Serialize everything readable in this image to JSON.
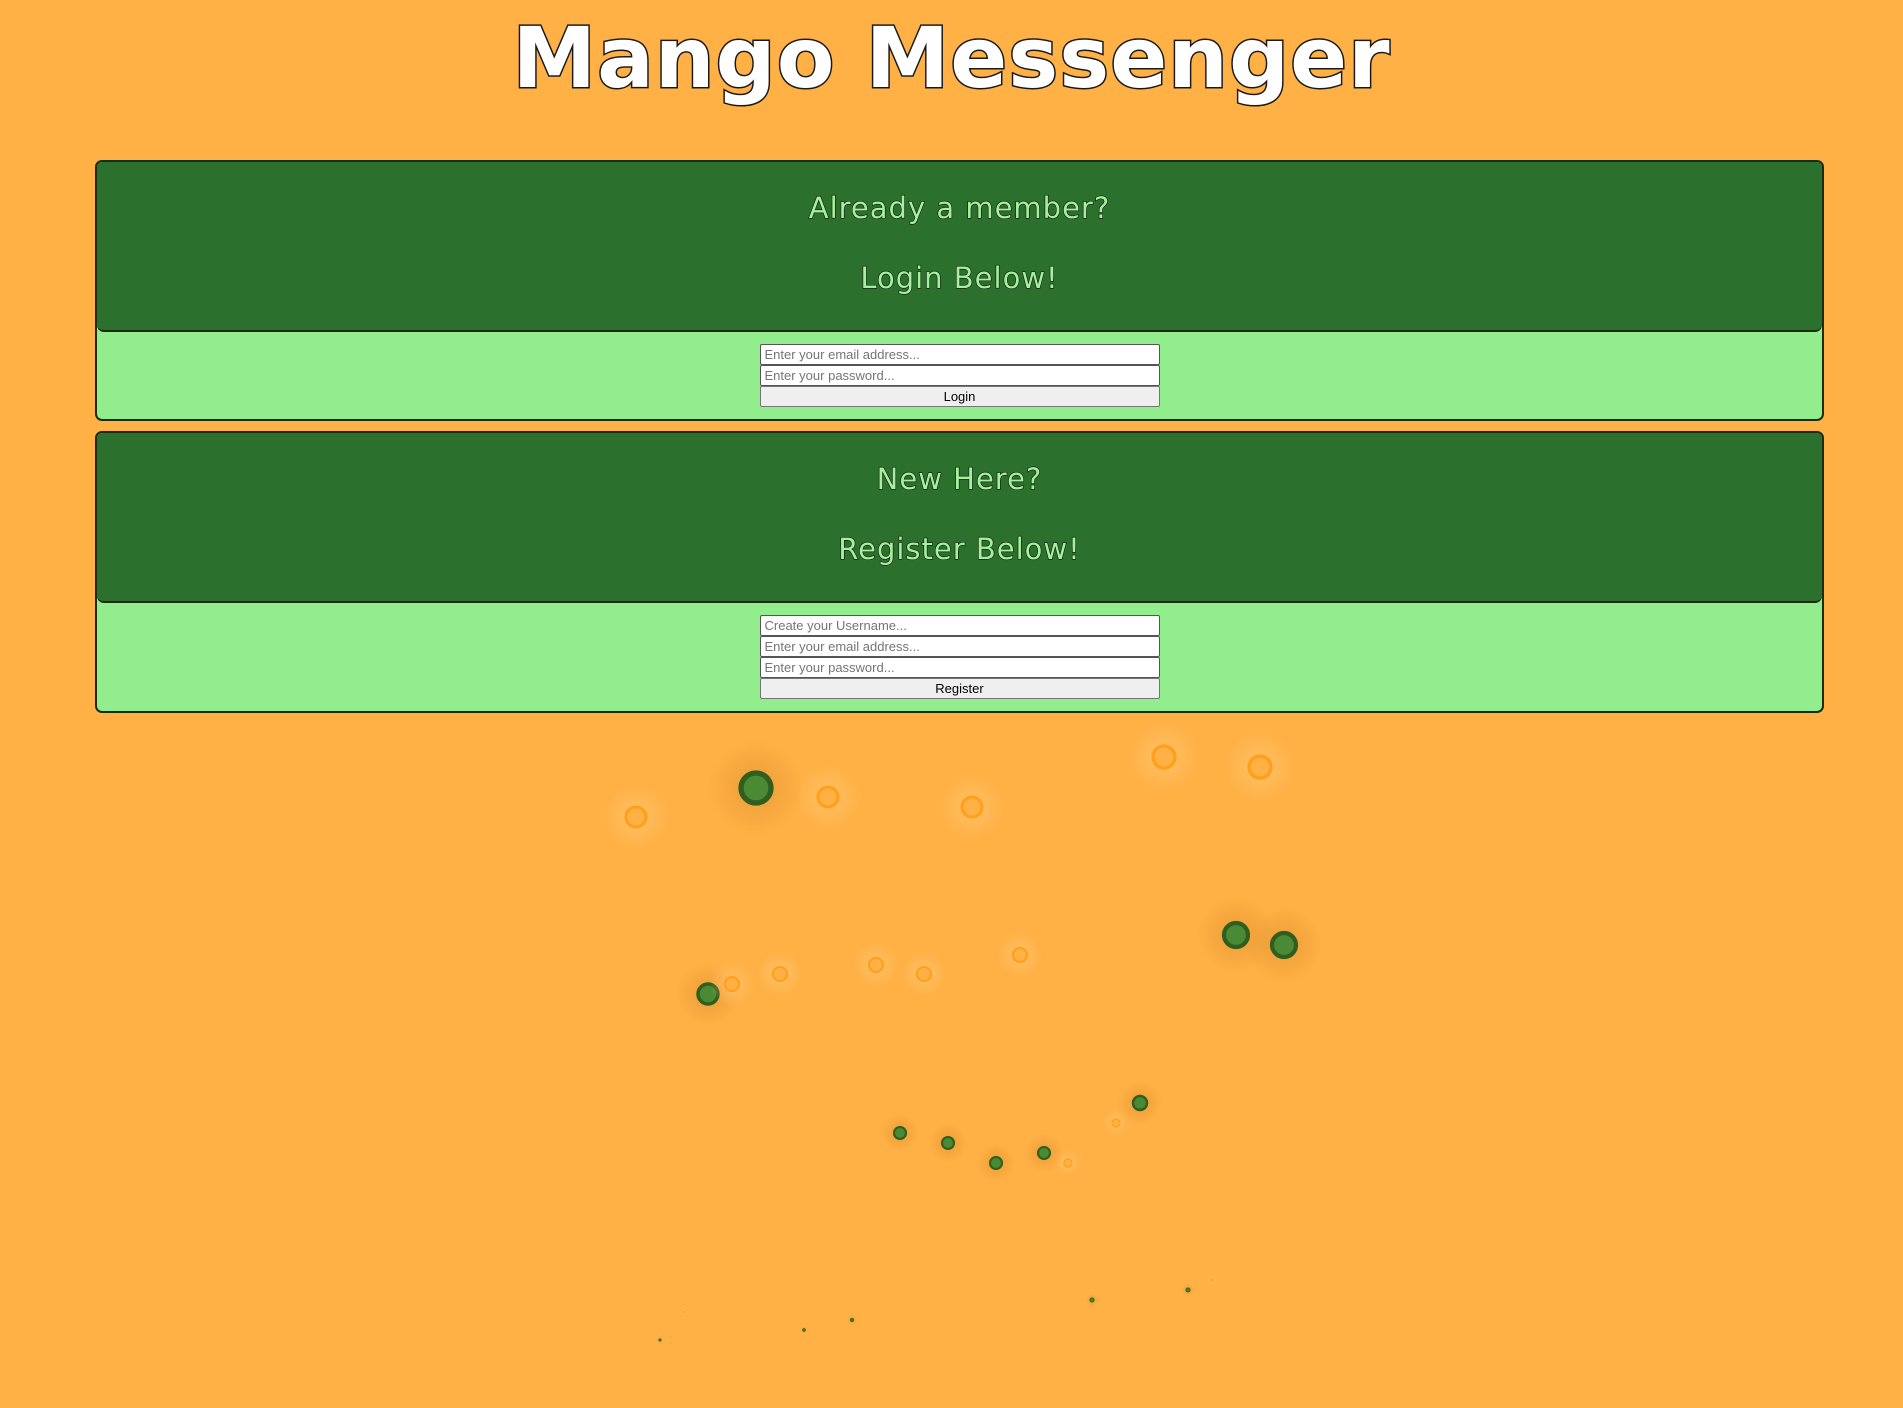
{
  "app": {
    "title": "Mango Messenger"
  },
  "login": {
    "heading_line1": "Already a member?",
    "heading_line2": "Login Below!",
    "email_placeholder": "Enter your email address...",
    "password_placeholder": "Enter your password...",
    "button_label": "Login"
  },
  "register": {
    "heading_line1": "New Here?",
    "heading_line2": "Register Below!",
    "username_placeholder": "Create your Username...",
    "email_placeholder": "Enter your email address...",
    "password_placeholder": "Enter your password...",
    "button_label": "Register"
  },
  "colors": {
    "background": "#ffb145",
    "panel_header": "#2c702d",
    "panel_body": "#92ed8c",
    "heading_text": "#a7ee9f",
    "bubble_green": "#2f5e1e",
    "bubble_orange": "#ff9f1a"
  }
}
